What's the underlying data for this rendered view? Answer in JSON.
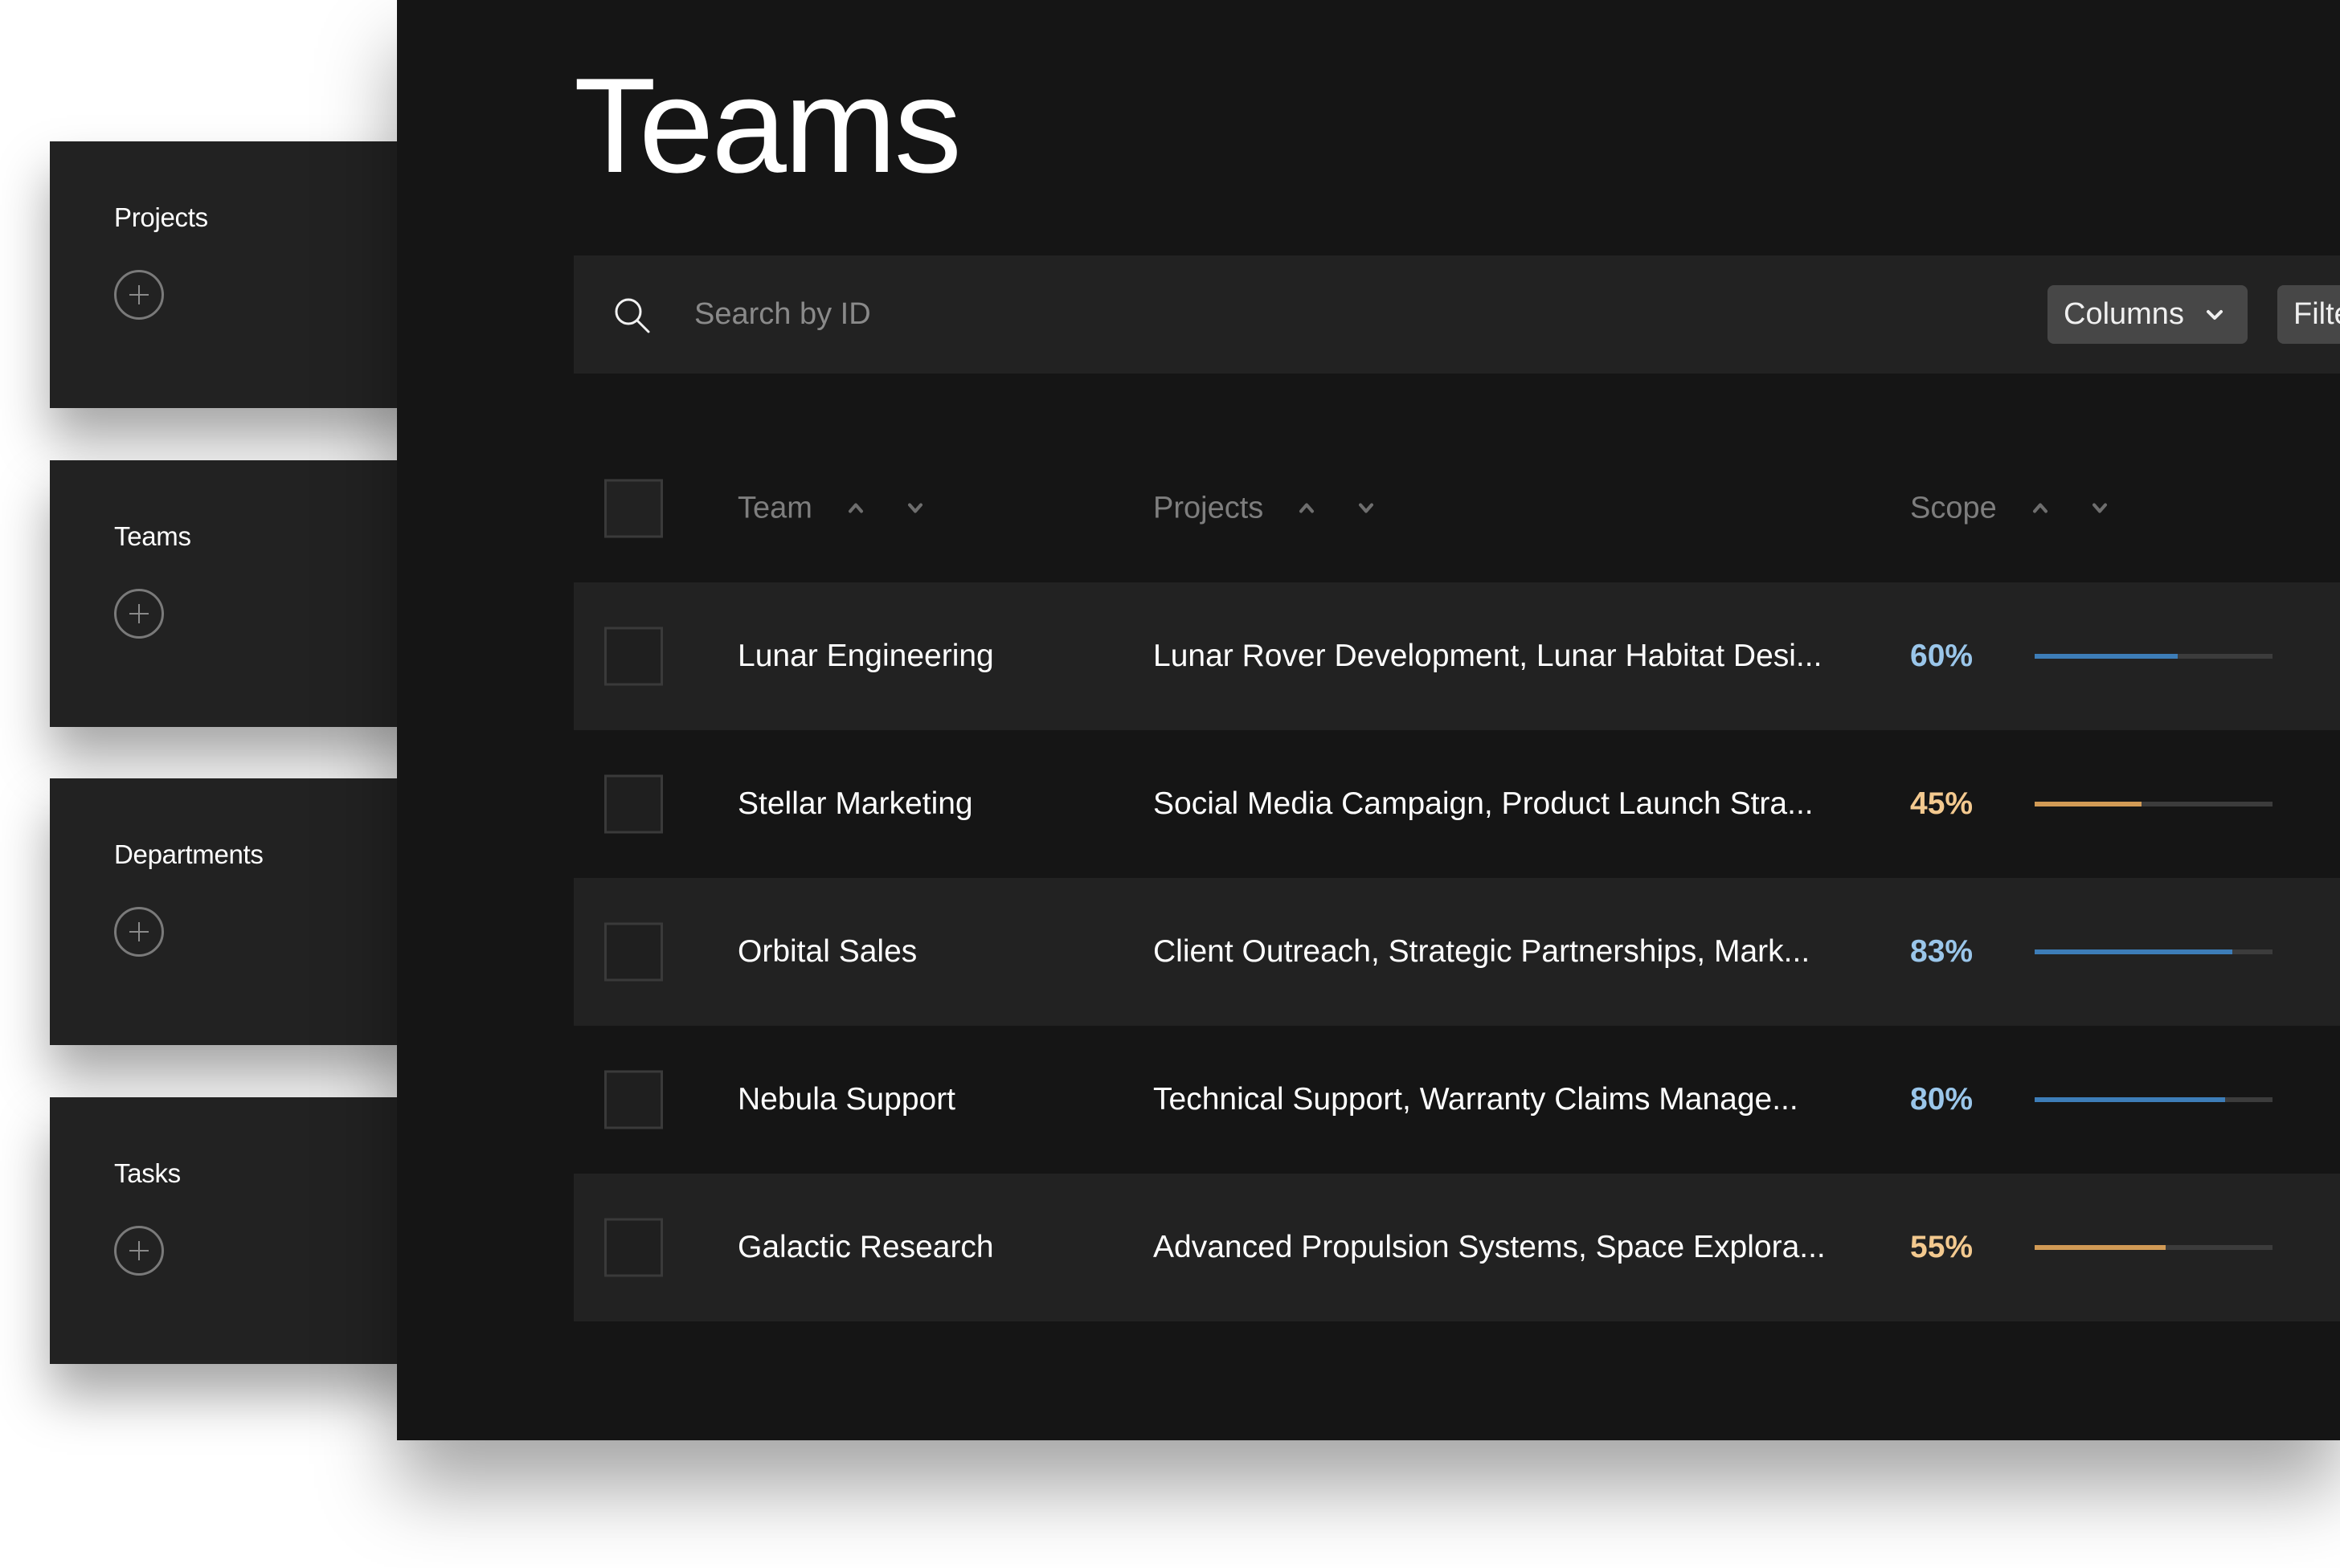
{
  "sidebar": {
    "cards": [
      {
        "label": "Projects",
        "icon": "plus-circle-icon"
      },
      {
        "label": "Teams",
        "icon": "plus-circle-icon"
      },
      {
        "label": "Departments",
        "icon": "plus-circle-icon"
      },
      {
        "label": "Tasks",
        "icon": "plus-circle-icon"
      }
    ]
  },
  "main": {
    "title": "Teams",
    "search": {
      "placeholder": "Search by ID",
      "value": "",
      "icon": "search-icon"
    },
    "toolbar": {
      "columns_label": "Columns",
      "filter_label": "Filter"
    },
    "table": {
      "headers": [
        {
          "label": "Team"
        },
        {
          "label": "Projects"
        },
        {
          "label": "Scope"
        }
      ],
      "rows": [
        {
          "team": "Lunar Engineering",
          "projects": "Lunar Rover Development, Lunar Habitat Desi...",
          "scope_label": "60%",
          "scope": 60,
          "tone": "blue"
        },
        {
          "team": "Stellar Marketing",
          "projects": "Social Media Campaign, Product Launch Stra...",
          "scope_label": "45%",
          "scope": 45,
          "tone": "orange"
        },
        {
          "team": "Orbital Sales",
          "projects": "Client Outreach, Strategic Partnerships, Mark...",
          "scope_label": "83%",
          "scope": 83,
          "tone": "blue"
        },
        {
          "team": "Nebula Support",
          "projects": "Technical Support, Warranty Claims Manage...",
          "scope_label": "80%",
          "scope": 80,
          "tone": "blue"
        },
        {
          "team": "Galactic Research",
          "projects": "Advanced Propulsion Systems, Space Explora...",
          "scope_label": "55%",
          "scope": 55,
          "tone": "orange"
        }
      ]
    }
  },
  "colors": {
    "blue_text": "#9ac6ea",
    "blue_bar": "#3d7db8",
    "orange_text": "#f3c98f",
    "orange_bar": "#d19a55",
    "track": "#3c3c3c"
  }
}
